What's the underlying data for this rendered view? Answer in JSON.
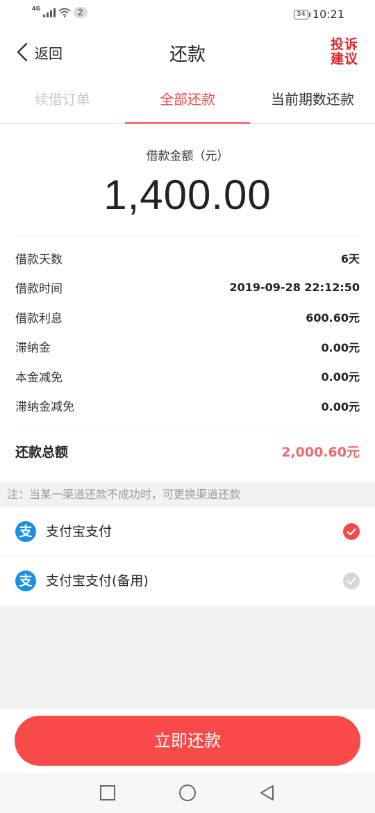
{
  "status_bar": {
    "network": "4G",
    "notification_count": "2",
    "battery": "34",
    "time": "10:21"
  },
  "header": {
    "back_label": "返回",
    "title": "还款",
    "complain_label": "投诉建议"
  },
  "tabs": [
    {
      "label": "续借订单",
      "state": "disabled"
    },
    {
      "label": "全部还款",
      "state": "active"
    },
    {
      "label": "当前期数还款",
      "state": "normal"
    }
  ],
  "amount": {
    "label": "借款金额（元）",
    "value": "1,400.00"
  },
  "details": [
    {
      "key": "借款天数",
      "value": "6天"
    },
    {
      "key": "借款时间",
      "value": "2019-09-28 22:12:50"
    },
    {
      "key": "借款利息",
      "value": "600.60元"
    },
    {
      "key": "滞纳金",
      "value": "0.00元"
    },
    {
      "key": "本金减免",
      "value": "0.00元"
    },
    {
      "key": "滞纳金减免",
      "value": "0.00元"
    }
  ],
  "total": {
    "label": "还款总额",
    "value": "2,000.60元"
  },
  "note": "注：当某一渠道还款不成功时，可更换渠道还款",
  "payment_methods": [
    {
      "icon": "支",
      "label": "支付宝支付",
      "selected": true
    },
    {
      "icon": "支",
      "label": "支付宝支付(备用)",
      "selected": false
    }
  ],
  "submit_label": "立即还款",
  "colors": {
    "accent": "#f04a4a",
    "total": "#f06a6a",
    "alipay": "#1a8fe3",
    "button": "#f94a4a"
  }
}
